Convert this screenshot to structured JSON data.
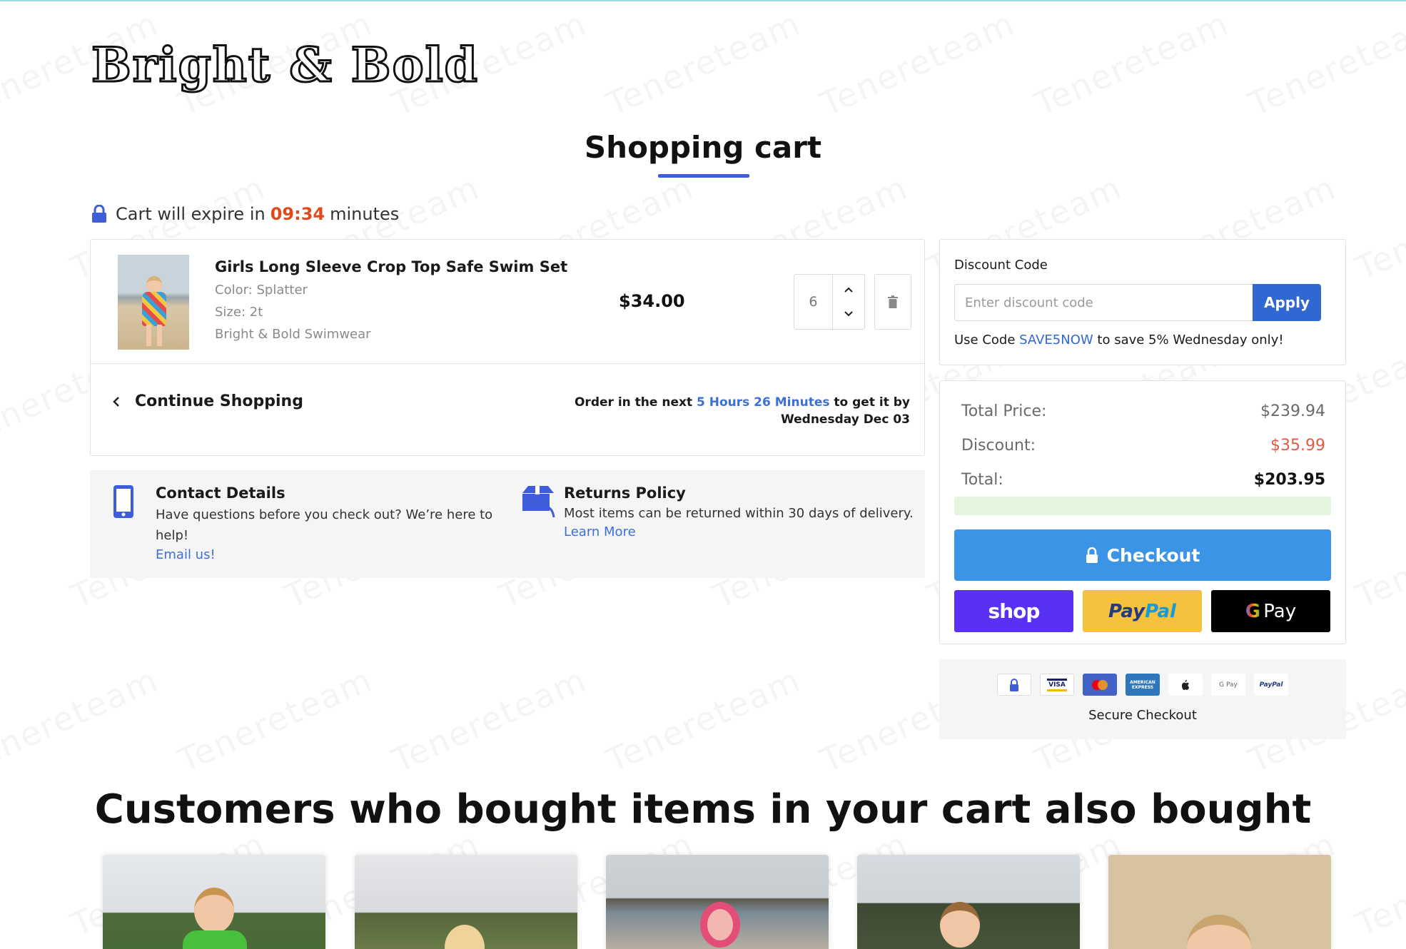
{
  "brand": {
    "logo_text": "Bright & Bold"
  },
  "header": {
    "title": "Shopping cart"
  },
  "expire": {
    "prefix": "Cart will expire in",
    "time": "09:34",
    "suffix": "minutes"
  },
  "cart": {
    "items": [
      {
        "name": "Girls Long Sleeve Crop Top Safe Swim Set",
        "color": "Color: Splatter",
        "size": "Size: 2t",
        "vendor": "Bright & Bold Swimwear",
        "price": "$34.00",
        "quantity": "6"
      }
    ],
    "continue_label": "Continue Shopping",
    "order_in": {
      "prefix": "Order in the next",
      "highlight": "5 Hours 26 Minutes",
      "suffix": "to get it by Wednesday Dec 03"
    }
  },
  "info": {
    "contact": {
      "title": "Contact Details",
      "text": "Have questions before you check out? We’re here to help!",
      "link": "Email us!"
    },
    "returns": {
      "title": "Returns Policy",
      "text": "Most items can be returned within 30 days of delivery.",
      "link": "Learn More"
    }
  },
  "discount": {
    "label": "Discount Code",
    "placeholder": "Enter discount code",
    "apply_label": "Apply",
    "note_prefix": "Use Code",
    "note_code": "SAVE5NOW",
    "note_suffix": "to save 5% Wednesday only!"
  },
  "totals": {
    "total_price_label": "Total Price:",
    "total_price": "$239.94",
    "discount_label": "Discount:",
    "discount": "$35.99",
    "total_label": "Total:",
    "total": "$203.95",
    "progress": 0.0
  },
  "checkout": {
    "checkout_label": "Checkout",
    "shop_label": "shop",
    "paypal_label_1": "Pay",
    "paypal_label_2": "Pal",
    "gpay_g": "G",
    "gpay_label": "Pay"
  },
  "secure": {
    "label": "Secure Checkout",
    "badges": [
      {
        "icon": "lock-icon",
        "label": ""
      },
      {
        "icon": "visa-icon",
        "label": "VISA"
      },
      {
        "icon": "mastercard-icon",
        "label": ""
      },
      {
        "icon": "amex-icon",
        "label": "AMERICAN EXPRESS"
      },
      {
        "icon": "apple-pay-icon",
        "label": ""
      },
      {
        "icon": "google-pay-icon",
        "label": "G Pay"
      },
      {
        "icon": "paypal-icon",
        "label": "PayPal"
      }
    ]
  },
  "also_bought": {
    "title": "Customers who bought items in your cart also bought"
  },
  "watermark_text": "Tenereteam",
  "colors": {
    "accent": "#3d5ed8",
    "expire_time": "#e24a1c",
    "link": "#3d6fd8",
    "apply": "#2f67d3",
    "checkout": "#3c94e6",
    "shop": "#5a31f4",
    "paypal": "#f6c23e",
    "discount_red": "#e05a4a"
  }
}
